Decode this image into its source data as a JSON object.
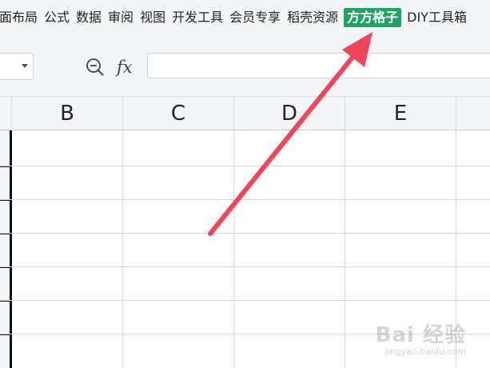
{
  "menubar": {
    "items": [
      {
        "label": "面布局"
      },
      {
        "label": "公式"
      },
      {
        "label": "数据"
      },
      {
        "label": "审阅"
      },
      {
        "label": "视图"
      },
      {
        "label": "开发工具"
      },
      {
        "label": "会员专享"
      },
      {
        "label": "稻壳资源"
      },
      {
        "label": "方方格子",
        "highlighted": true
      },
      {
        "label": "DIY工具箱"
      }
    ],
    "highlight_color": "#21a366"
  },
  "formulabar": {
    "zoom_icon": "zoom-magnifier-icon",
    "fx_label": "fx",
    "value": ""
  },
  "columns": [
    "B",
    "C",
    "D",
    "E"
  ],
  "annotation": {
    "type": "arrow",
    "color": "#f0455a",
    "points_to": "方方格子"
  },
  "watermark": {
    "main": "Bai 经验",
    "sub": "jingyan.baidu.com"
  }
}
